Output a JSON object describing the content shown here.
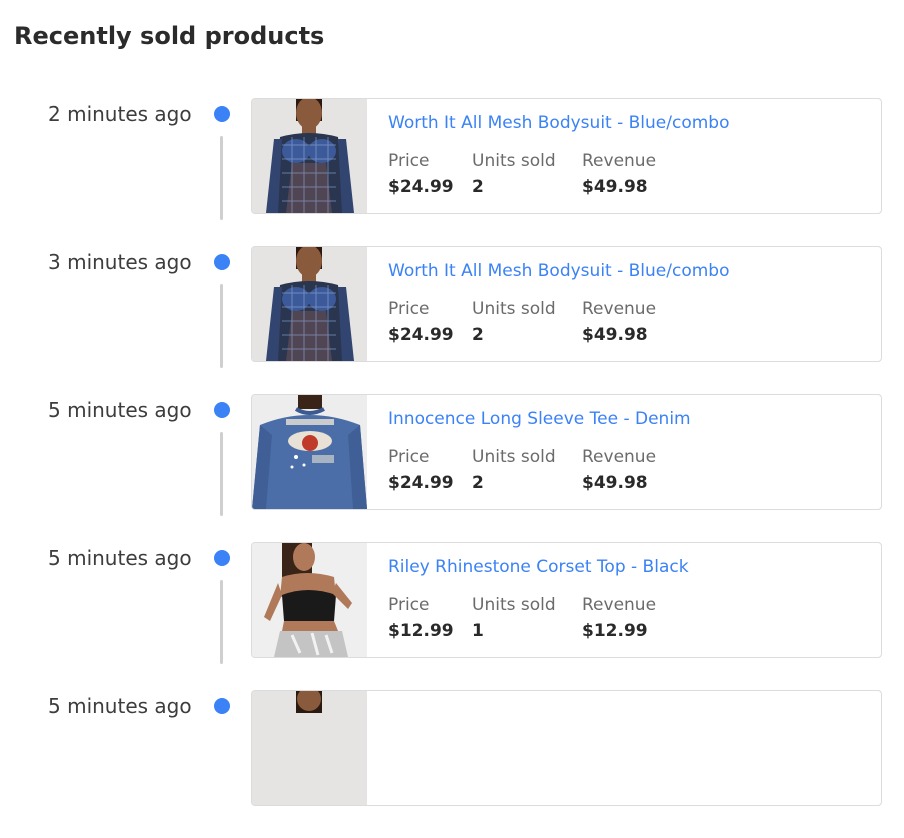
{
  "title": "Recently sold products",
  "labels": {
    "price": "Price",
    "units": "Units sold",
    "revenue": "Revenue"
  },
  "entries": [
    {
      "time": "2 minutes ago",
      "name": "Worth It All Mesh Bodysuit - Blue/combo",
      "price": "$24.99",
      "units": "2",
      "revenue": "$49.98",
      "image": "mesh-bodysuit-photo"
    },
    {
      "time": "3 minutes ago",
      "name": "Worth It All Mesh Bodysuit - Blue/combo",
      "price": "$24.99",
      "units": "2",
      "revenue": "$49.98",
      "image": "mesh-bodysuit-photo"
    },
    {
      "time": "5 minutes ago",
      "name": "Innocence Long Sleeve Tee - Denim",
      "price": "$24.99",
      "units": "2",
      "revenue": "$49.98",
      "image": "long-sleeve-tee-photo"
    },
    {
      "time": "5 minutes ago",
      "name": "Riley Rhinestone Corset Top - Black",
      "price": "$12.99",
      "units": "1",
      "revenue": "$12.99",
      "image": "corset-top-photo"
    },
    {
      "time": "5 minutes ago",
      "image": "product-photo"
    }
  ],
  "colors": {
    "accent": "#3b82f6",
    "timeline": "#cfcfcf"
  }
}
